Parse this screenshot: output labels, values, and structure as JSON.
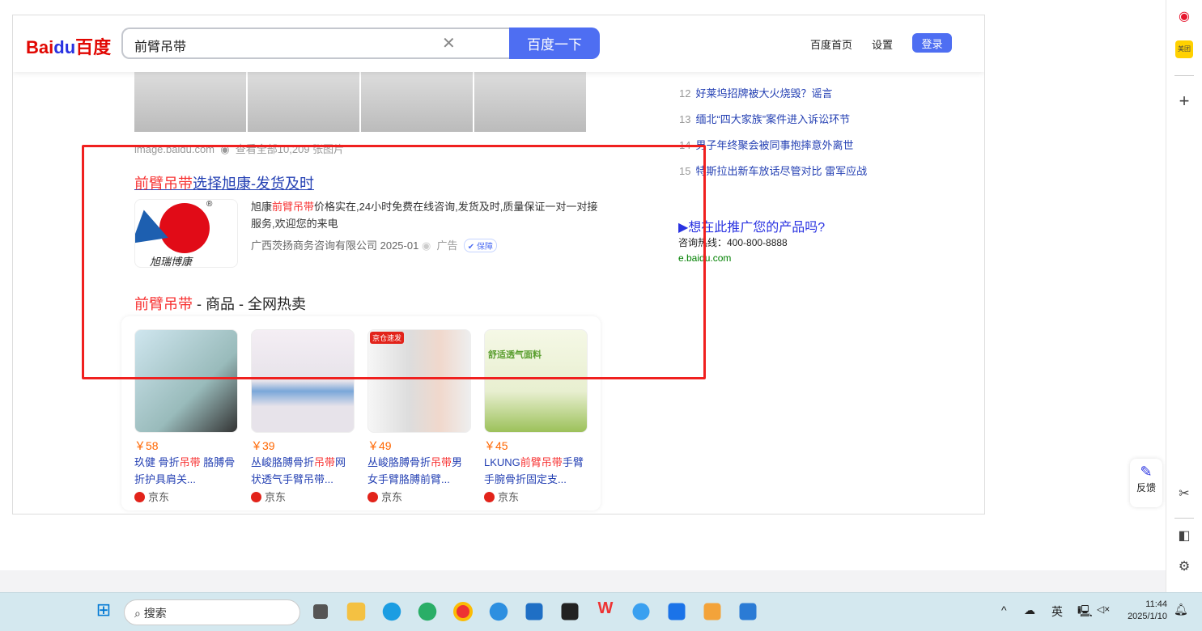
{
  "header": {
    "logo_text": "Bai百度",
    "search_value": "前臂吊带",
    "search_button": "百度一下",
    "nav": [
      "百度首页",
      "设置"
    ],
    "login": "登录"
  },
  "images_meta": {
    "source": "image.baidu.com",
    "count": "查看全部10,209 张图片"
  },
  "ad": {
    "title_red": "前臂吊带",
    "title_rest": "选择旭康-发货及时",
    "desc_pre": "旭康",
    "desc_red": "前臂吊带",
    "desc_post": "价格实在,24小时免费在线咨询,发货及时,质量保证一对一对接服务,欢迎您的来电",
    "company": "广西茨扬商务咨询有限公司 2025-01",
    "ad_label": "广告",
    "guarantee": "保障",
    "logo_text": "旭瑞博康"
  },
  "products": {
    "title_red": "前臂吊带",
    "title_rest": " - 商品 - 全网热卖",
    "items": [
      {
        "price": "￥58",
        "name_a": "玖健 骨折",
        "name_red": "吊带",
        "name_b": " 胳膊骨折护具肩关...",
        "shop": "京东",
        "tag": ""
      },
      {
        "price": "￥39",
        "name_a": "丛峻胳膊骨折",
        "name_red": "吊带",
        "name_b": "网状透气手臂吊带...",
        "shop": "京东",
        "tag": ""
      },
      {
        "price": "￥49",
        "name_a": "丛峻胳膊骨折",
        "name_red": "吊带",
        "name_b": "男女手臂胳膊前臂...",
        "shop": "京东",
        "tag": "京仓速发"
      },
      {
        "price": "￥45",
        "name_a": "LKUNG",
        "name_red": "前臂吊带",
        "name_b": "手臂手腕骨折固定支...",
        "shop": "京东",
        "tag": "舒适透气面料"
      }
    ]
  },
  "hot_list": [
    {
      "n": "12",
      "t": "好莱坞招牌被大火烧毁？谣言"
    },
    {
      "n": "13",
      "t": "缅北“四大家族”案件进入诉讼环节"
    },
    {
      "n": "14",
      "t": "男子年终聚会被同事抱摔意外离世"
    },
    {
      "n": "15",
      "t": "特斯拉出新车放话尽管对比 雷军应战"
    }
  ],
  "promo": {
    "title": "▶想在此推广您的产品吗?",
    "hotline": "咨询热线：400-800-8888",
    "url": "e.baidu.com"
  },
  "feedback": "反馈",
  "taskbar": {
    "search": "搜索",
    "ime": "英",
    "time": "11:44",
    "date": "2025/1/10"
  },
  "colors": {
    "accent": "#4e6ef2",
    "highlight": "#f73131",
    "annotation": "#f0201f"
  }
}
